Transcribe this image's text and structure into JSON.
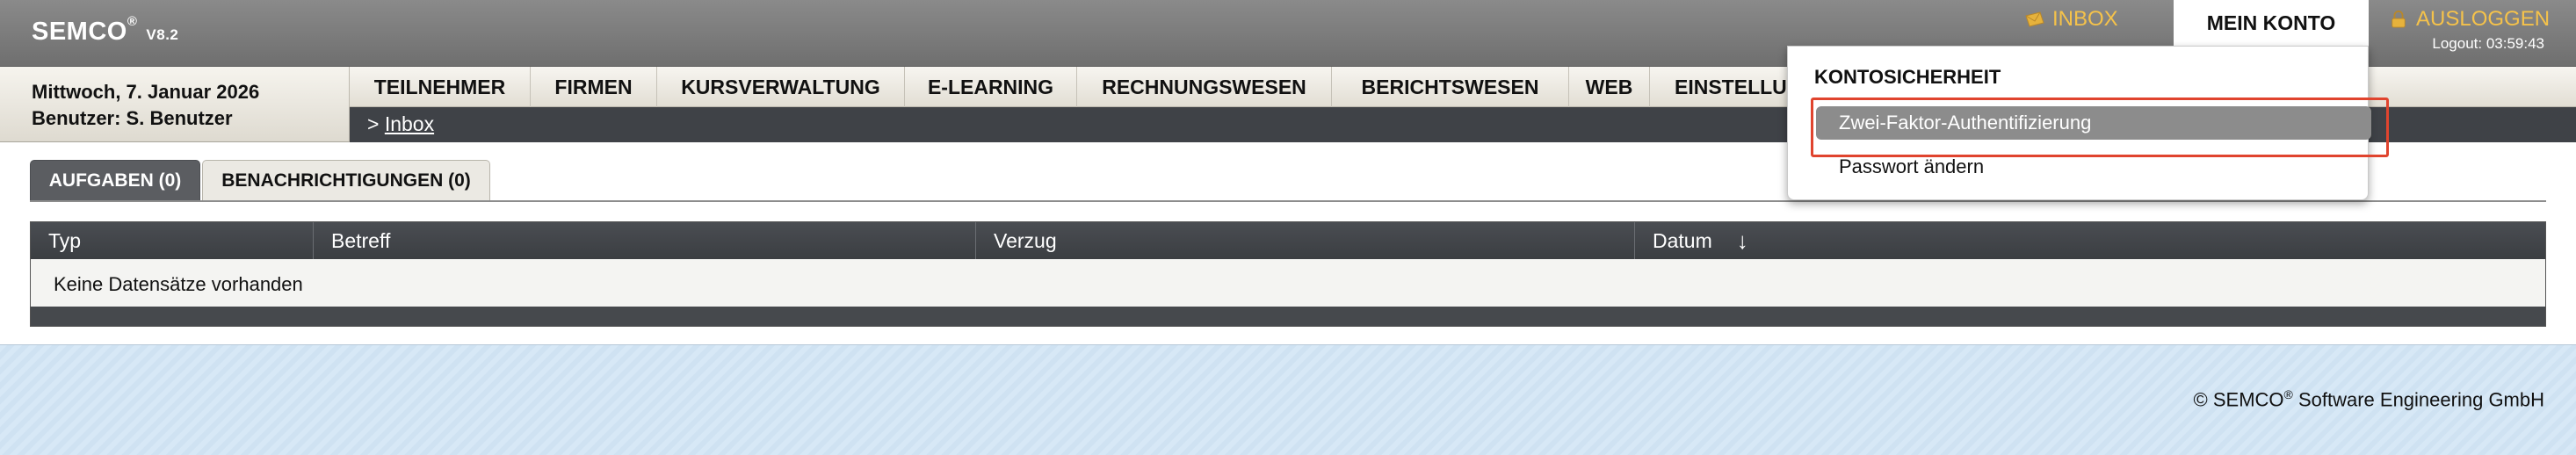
{
  "app": {
    "name": "SEMCO",
    "version": "V8.2"
  },
  "header": {
    "inbox_label": "INBOX",
    "mein_konto_label": "MEIN KONTO",
    "logout_label": "AUSLOGGEN",
    "logout_timer": "Logout: 03:59:43"
  },
  "info": {
    "date": "Mittwoch, 7. Januar 2026",
    "user": "Benutzer: S. Benutzer"
  },
  "nav": {
    "items": [
      {
        "label": "TEILNEHMER"
      },
      {
        "label": "FIRMEN"
      },
      {
        "label": "KURSVERWALTUNG"
      },
      {
        "label": "E-LEARNING"
      },
      {
        "label": "RECHNUNGSWESEN"
      },
      {
        "label": "BERICHTSWESEN"
      },
      {
        "label": "WEB"
      },
      {
        "label": "EINSTELLUNGEN"
      }
    ]
  },
  "breadcrumb": {
    "prefix": ">",
    "current": "Inbox"
  },
  "tabs": [
    {
      "label": "AUFGABEN (0)",
      "active": true
    },
    {
      "label": "BENACHRICHTIGUNGEN (0)",
      "active": false
    }
  ],
  "table": {
    "columns": [
      "Typ",
      "Betreff",
      "Verzug",
      "Datum"
    ],
    "sort_indicator": "↓",
    "empty_message": "Keine Datensätze vorhanden"
  },
  "dropdown": {
    "title": "KONTOSICHERHEIT",
    "items": [
      {
        "label": "Zwei-Faktor-Authentifizierung",
        "highlighted": true
      },
      {
        "label": "Passwort ändern",
        "highlighted": false
      }
    ]
  },
  "footer": {
    "copyright_prefix": "© SEMCO",
    "copyright_mark": "®",
    "copyright_suffix": " Software Engineering GmbH"
  },
  "colors": {
    "accent_gold": "#f5c24a",
    "header_gray": "#7b7b7b",
    "dark_bar": "#3f4247",
    "highlight_red": "#e0442e"
  }
}
